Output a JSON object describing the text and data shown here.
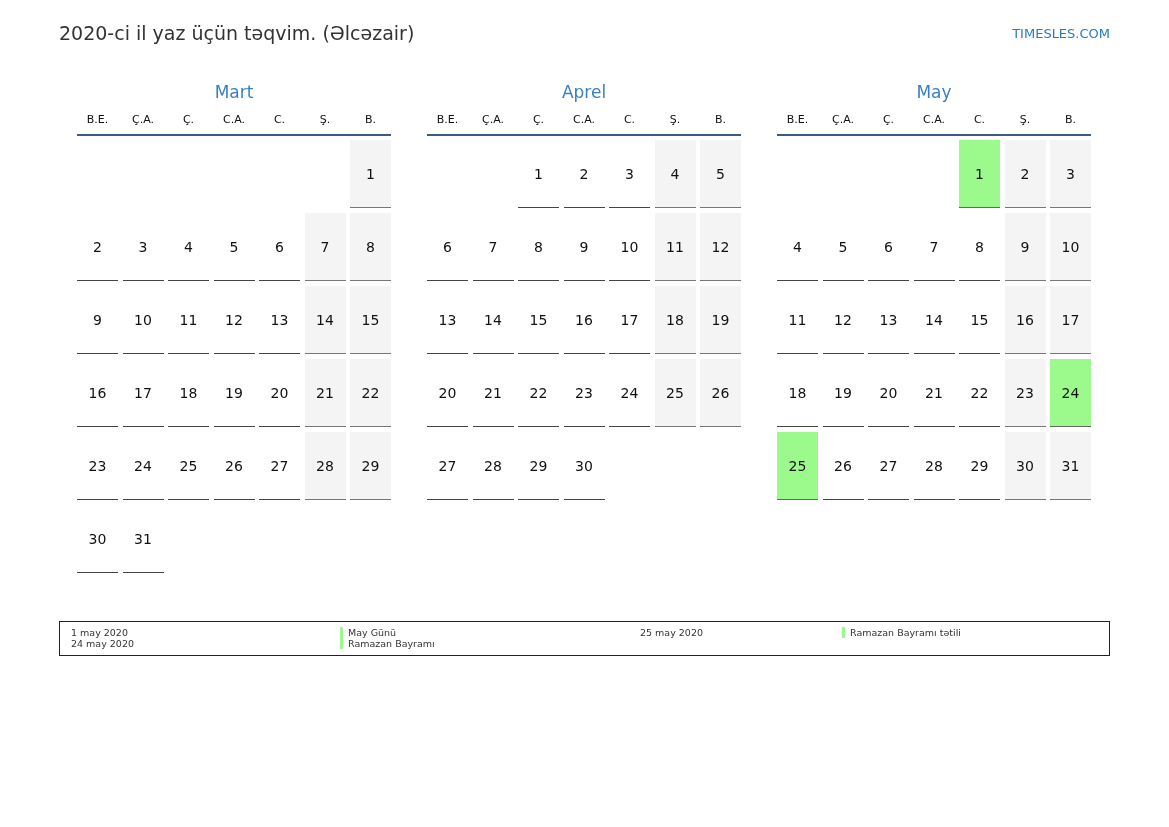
{
  "title": "2020-ci il yaz üçün təqvim. (Əlcəzair)",
  "brand": "TIMESLES.COM",
  "months": [
    {
      "name": "Mart",
      "weekdays": [
        "B.E.",
        "Ç.A.",
        "Ç.",
        "C.A.",
        "C.",
        "Ş.",
        "B."
      ],
      "weeks": [
        [
          {
            "kind": "blank"
          },
          {
            "kind": "blank"
          },
          {
            "kind": "blank"
          },
          {
            "kind": "blank"
          },
          {
            "kind": "blank"
          },
          {
            "kind": "blank"
          },
          {
            "day": "1",
            "kind": "weekend"
          }
        ],
        [
          {
            "day": "2",
            "kind": "workday"
          },
          {
            "day": "3",
            "kind": "workday"
          },
          {
            "day": "4",
            "kind": "workday"
          },
          {
            "day": "5",
            "kind": "workday"
          },
          {
            "day": "6",
            "kind": "workday"
          },
          {
            "day": "7",
            "kind": "weekend"
          },
          {
            "day": "8",
            "kind": "weekend"
          }
        ],
        [
          {
            "day": "9",
            "kind": "workday"
          },
          {
            "day": "10",
            "kind": "workday"
          },
          {
            "day": "11",
            "kind": "workday"
          },
          {
            "day": "12",
            "kind": "workday"
          },
          {
            "day": "13",
            "kind": "workday"
          },
          {
            "day": "14",
            "kind": "weekend"
          },
          {
            "day": "15",
            "kind": "weekend"
          }
        ],
        [
          {
            "day": "16",
            "kind": "workday"
          },
          {
            "day": "17",
            "kind": "workday"
          },
          {
            "day": "18",
            "kind": "workday"
          },
          {
            "day": "19",
            "kind": "workday"
          },
          {
            "day": "20",
            "kind": "workday"
          },
          {
            "day": "21",
            "kind": "weekend"
          },
          {
            "day": "22",
            "kind": "weekend"
          }
        ],
        [
          {
            "day": "23",
            "kind": "workday"
          },
          {
            "day": "24",
            "kind": "workday"
          },
          {
            "day": "25",
            "kind": "workday"
          },
          {
            "day": "26",
            "kind": "workday"
          },
          {
            "day": "27",
            "kind": "workday"
          },
          {
            "day": "28",
            "kind": "weekend"
          },
          {
            "day": "29",
            "kind": "weekend"
          }
        ],
        [
          {
            "day": "30",
            "kind": "workday"
          },
          {
            "day": "31",
            "kind": "workday"
          }
        ]
      ]
    },
    {
      "name": "Aprel",
      "weekdays": [
        "B.E.",
        "Ç.A.",
        "Ç.",
        "C.A.",
        "C.",
        "Ş.",
        "B."
      ],
      "weeks": [
        [
          {
            "kind": "blank"
          },
          {
            "kind": "blank"
          },
          {
            "day": "1",
            "kind": "workday"
          },
          {
            "day": "2",
            "kind": "workday"
          },
          {
            "day": "3",
            "kind": "workday"
          },
          {
            "day": "4",
            "kind": "weekend"
          },
          {
            "day": "5",
            "kind": "weekend"
          }
        ],
        [
          {
            "day": "6",
            "kind": "workday"
          },
          {
            "day": "7",
            "kind": "workday"
          },
          {
            "day": "8",
            "kind": "workday"
          },
          {
            "day": "9",
            "kind": "workday"
          },
          {
            "day": "10",
            "kind": "workday"
          },
          {
            "day": "11",
            "kind": "weekend"
          },
          {
            "day": "12",
            "kind": "weekend"
          }
        ],
        [
          {
            "day": "13",
            "kind": "workday"
          },
          {
            "day": "14",
            "kind": "workday"
          },
          {
            "day": "15",
            "kind": "workday"
          },
          {
            "day": "16",
            "kind": "workday"
          },
          {
            "day": "17",
            "kind": "workday"
          },
          {
            "day": "18",
            "kind": "weekend"
          },
          {
            "day": "19",
            "kind": "weekend"
          }
        ],
        [
          {
            "day": "20",
            "kind": "workday"
          },
          {
            "day": "21",
            "kind": "workday"
          },
          {
            "day": "22",
            "kind": "workday"
          },
          {
            "day": "23",
            "kind": "workday"
          },
          {
            "day": "24",
            "kind": "workday"
          },
          {
            "day": "25",
            "kind": "weekend"
          },
          {
            "day": "26",
            "kind": "weekend"
          }
        ],
        [
          {
            "day": "27",
            "kind": "workday"
          },
          {
            "day": "28",
            "kind": "workday"
          },
          {
            "day": "29",
            "kind": "workday"
          },
          {
            "day": "30",
            "kind": "workday"
          }
        ]
      ]
    },
    {
      "name": "May",
      "weekdays": [
        "B.E.",
        "Ç.A.",
        "Ç.",
        "C.A.",
        "C.",
        "Ş.",
        "B."
      ],
      "weeks": [
        [
          {
            "kind": "blank"
          },
          {
            "kind": "blank"
          },
          {
            "kind": "blank"
          },
          {
            "kind": "blank"
          },
          {
            "day": "1",
            "kind": "holiday"
          },
          {
            "day": "2",
            "kind": "weekend"
          },
          {
            "day": "3",
            "kind": "weekend"
          }
        ],
        [
          {
            "day": "4",
            "kind": "workday"
          },
          {
            "day": "5",
            "kind": "workday"
          },
          {
            "day": "6",
            "kind": "workday"
          },
          {
            "day": "7",
            "kind": "workday"
          },
          {
            "day": "8",
            "kind": "workday"
          },
          {
            "day": "9",
            "kind": "weekend"
          },
          {
            "day": "10",
            "kind": "weekend"
          }
        ],
        [
          {
            "day": "11",
            "kind": "workday"
          },
          {
            "day": "12",
            "kind": "workday"
          },
          {
            "day": "13",
            "kind": "workday"
          },
          {
            "day": "14",
            "kind": "workday"
          },
          {
            "day": "15",
            "kind": "workday"
          },
          {
            "day": "16",
            "kind": "weekend"
          },
          {
            "day": "17",
            "kind": "weekend"
          }
        ],
        [
          {
            "day": "18",
            "kind": "workday"
          },
          {
            "day": "19",
            "kind": "workday"
          },
          {
            "day": "20",
            "kind": "workday"
          },
          {
            "day": "21",
            "kind": "workday"
          },
          {
            "day": "22",
            "kind": "workday"
          },
          {
            "day": "23",
            "kind": "weekend"
          },
          {
            "day": "24",
            "kind": "holiday"
          }
        ],
        [
          {
            "day": "25",
            "kind": "holiday"
          },
          {
            "day": "26",
            "kind": "workday"
          },
          {
            "day": "27",
            "kind": "workday"
          },
          {
            "day": "28",
            "kind": "workday"
          },
          {
            "day": "29",
            "kind": "workday"
          },
          {
            "day": "30",
            "kind": "weekend"
          },
          {
            "day": "31",
            "kind": "weekend"
          }
        ]
      ]
    }
  ],
  "legend": [
    [
      {
        "date": "1 may 2020",
        "name": "May Günü"
      },
      {
        "date": "24 may 2020",
        "name": "Ramazan Bayramı"
      }
    ],
    [
      {
        "date": "25 may 2020",
        "name": "Ramazan Bayramı tətili"
      }
    ]
  ]
}
